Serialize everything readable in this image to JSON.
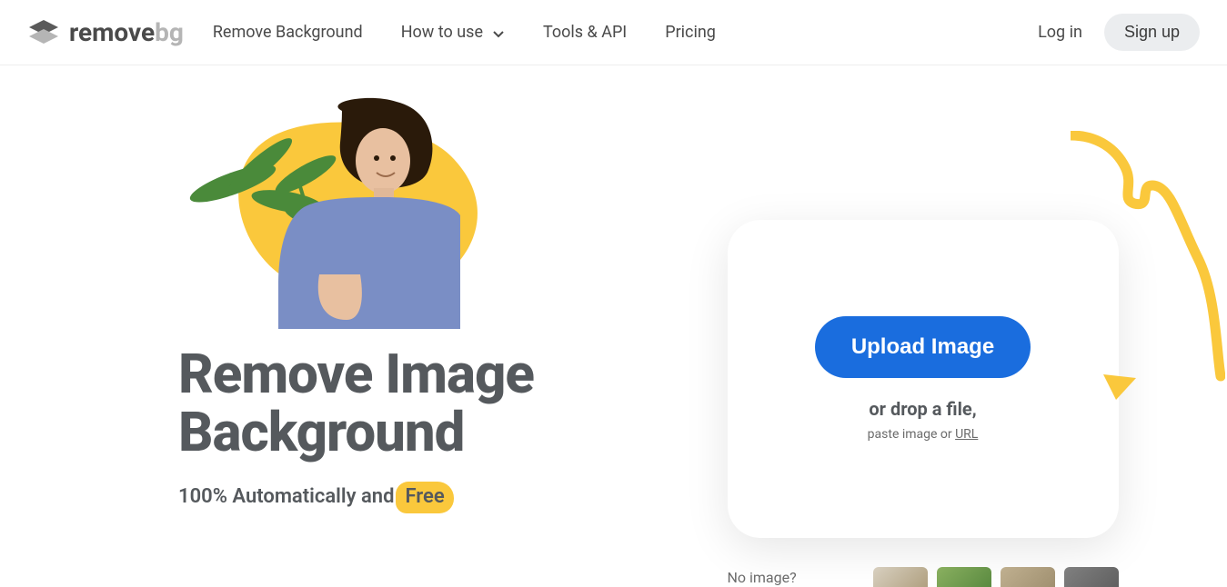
{
  "logo": {
    "primary": "remove",
    "secondary": "bg"
  },
  "nav": {
    "items": [
      {
        "label": "Remove Background"
      },
      {
        "label": "How to use"
      },
      {
        "label": "Tools & API"
      },
      {
        "label": "Pricing"
      }
    ]
  },
  "auth": {
    "login": "Log in",
    "signup": "Sign up"
  },
  "hero": {
    "title_line1": "Remove Image",
    "title_line2": "Background",
    "sub_prefix": "100% Automatically and",
    "sub_highlight": "Free"
  },
  "upload": {
    "button": "Upload Image",
    "drop_text": "or drop a file,",
    "paste_prefix": "paste image or ",
    "paste_link": "URL"
  },
  "samples": {
    "no_image": "No image?"
  },
  "colors": {
    "accent_yellow": "#fac83c",
    "primary_blue": "#1a6dde"
  }
}
